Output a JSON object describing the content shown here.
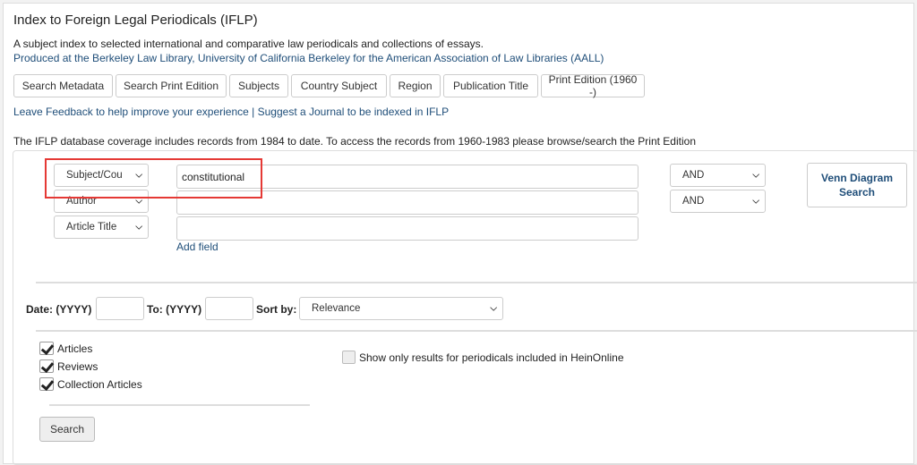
{
  "title": "Index to Foreign Legal Periodicals (IFLP)",
  "subtitle": "A subject index to selected international and comparative law periodicals and collections of essays.",
  "produced": "Produced at the Berkeley Law Library, University of California Berkeley for the American Association of Law Libraries (AALL)",
  "nav": [
    "Search Metadata",
    "Search Print Edition",
    "Subjects",
    "Country Subject",
    "Region",
    "Publication Title",
    "Print Edition (1960 -)"
  ],
  "links": {
    "feedback": "Leave Feedback to help improve your experience",
    "sep": " | ",
    "suggest": "Suggest a Journal to be indexed in IFLP"
  },
  "coverage": "The IFLP database coverage includes records from 1984 to date. To access the records from 1960-1983 please browse/search the Print Edition",
  "search": {
    "rows": [
      {
        "field": "Subject/Cou",
        "value": "constitutional"
      },
      {
        "field": "Author",
        "value": ""
      },
      {
        "field": "Article Title",
        "value": ""
      }
    ],
    "operators": [
      "AND",
      "AND"
    ],
    "add_field": "Add field",
    "venn": "Venn Diagram Search",
    "date_label": "Date: (YYYY)",
    "to_label": "To: (YYYY)",
    "sort_label": "Sort by:",
    "sort_value": "Relevance",
    "types": [
      {
        "label": "Articles",
        "checked": true
      },
      {
        "label": "Reviews",
        "checked": true
      },
      {
        "label": "Collection Articles",
        "checked": true
      }
    ],
    "hein": {
      "label": "Show only results for periodicals included in HeinOnline",
      "checked": false
    },
    "submit": "Search"
  },
  "highlight_color": "#e53935"
}
